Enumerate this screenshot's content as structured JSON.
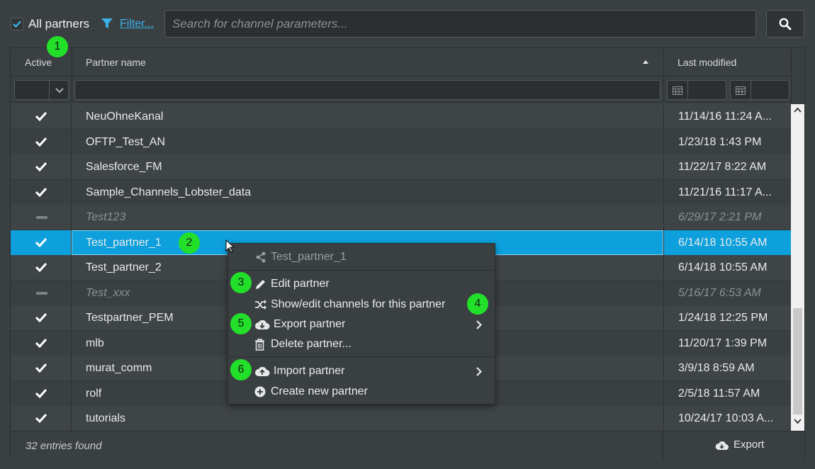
{
  "topbar": {
    "all_partners_label": "All partners",
    "filter_label": "Filter...",
    "search_placeholder": "Search for channel parameters..."
  },
  "columns": {
    "active": "Active",
    "partner_name": "Partner name",
    "last_modified": "Last modified"
  },
  "rows": [
    {
      "name": "NeuOhneKanal",
      "date": "11/14/16 11:24 A...",
      "active": true
    },
    {
      "name": "OFTP_Test_AN",
      "date": "1/23/18 1:43 PM",
      "active": true
    },
    {
      "name": "Salesforce_FM",
      "date": "11/22/17 8:22 AM",
      "active": true
    },
    {
      "name": "Sample_Channels_Lobster_data",
      "date": "11/21/16 11:17 A...",
      "active": true
    },
    {
      "name": "Test123",
      "date": "6/29/17 2:21 PM",
      "active": false
    },
    {
      "name": "Test_partner_1",
      "date": "6/14/18 10:55 AM",
      "active": true,
      "selected": true
    },
    {
      "name": "Test_partner_2",
      "date": "6/14/18 10:55 AM",
      "active": true
    },
    {
      "name": "Test_xxx",
      "date": "5/16/17 6:53 AM",
      "active": false
    },
    {
      "name": "Testpartner_PEM",
      "date": "1/24/18 12:25 PM",
      "active": true
    },
    {
      "name": "mlb",
      "date": "11/20/17 1:39 PM",
      "active": true
    },
    {
      "name": "murat_comm",
      "date": "3/9/18 8:59 AM",
      "active": true
    },
    {
      "name": "rolf",
      "date": "2/5/18 11:57 AM",
      "active": true
    },
    {
      "name": "tutorials",
      "date": "10/24/17 10:03 A...",
      "active": true
    }
  ],
  "footer": {
    "entries": "32 entries found",
    "export_label": "Export"
  },
  "context_menu": {
    "header": "Test_partner_1",
    "edit": "Edit partner",
    "show_channels": "Show/edit channels for this partner",
    "export": "Export partner",
    "delete": "Delete partner...",
    "import": "Import partner",
    "create": "Create new partner"
  },
  "badges": [
    "1",
    "2",
    "3",
    "4",
    "5",
    "6"
  ],
  "colors": {
    "accent": "#0ea0dc",
    "link": "#3ab0e8",
    "badge": "#22e02a",
    "background": "#3a3f41"
  },
  "icons": {
    "filter": "funnel-icon",
    "search": "magnifier-icon",
    "active": "checkmark-icon",
    "inactive": "dash-icon",
    "menu_header": "share-icon",
    "edit": "pencil-icon",
    "show_channels": "shuffle-icon",
    "export": "cloud-download-icon",
    "delete": "trash-icon",
    "import": "cloud-upload-icon",
    "create": "plus-circle-icon"
  }
}
